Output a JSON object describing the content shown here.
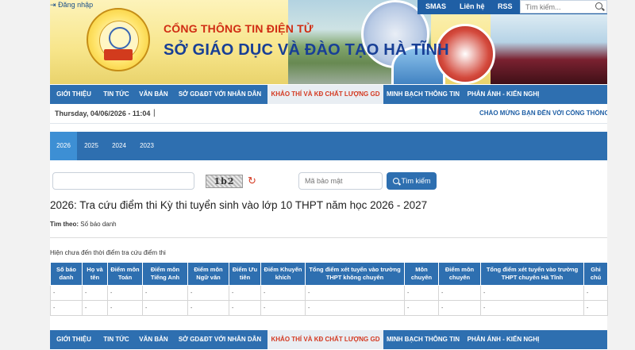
{
  "header": {
    "login_label": "Đăng nhập",
    "portal_label": "CỔNG THÔNG TIN ĐIỆN TỬ",
    "department_name": "SỞ GIÁO DỤC VÀ ĐÀO TẠO HÀ TĨNH",
    "top_links": [
      "SMAS",
      "Liên hệ",
      "RSS"
    ],
    "search_placeholder": "Tìm kiếm..."
  },
  "nav": {
    "items": [
      "GIỚI THIỆU",
      "TIN TỨC",
      "VĂN BẢN",
      "SỞ GD&ĐT VỚI NHÂN DÂN",
      "KHẢO THÍ VÀ KĐ CHẤT LƯỢNG GD",
      "MINH BẠCH THÔNG TIN",
      "PHẢN ÁNH - KIẾN NGHỊ"
    ],
    "active_index": 4
  },
  "dateline": {
    "date": "Thursday, 04/06/2026 - 11:04",
    "separator": "|",
    "marquee": "CHÀO MỪNG BẠN ĐẾN VỚI CỔNG THÔNG TIN"
  },
  "years": {
    "items": [
      "2026",
      "2025",
      "2024",
      "2023"
    ],
    "active_index": 0
  },
  "form": {
    "id_value": "",
    "captcha_text": "1b2",
    "security_placeholder": "Mã bảo mật",
    "search_button": "Tìm kiếm"
  },
  "content": {
    "title": "2026: Tra cứu điểm thi Kỳ thi tuyển sinh vào lớp 10 THPT năm học 2026 - 2027",
    "lookup_label": "Tìm theo:",
    "lookup_value": "Số báo danh",
    "notice": "Hiện chưa đến thời điểm tra cứu điểm thi"
  },
  "table": {
    "headers": [
      "Số báo danh",
      "Họ và tên",
      "Điểm môn Toán",
      "Điểm môn Tiếng Anh",
      "Điểm môn Ngữ văn",
      "Điểm Ưu tiên",
      "Điểm Khuyến khích",
      "Tổng điểm xét tuyển vào trường THPT không chuyên",
      "Môn chuyên",
      "Điểm môn chuyên",
      "Tổng điểm xét tuyển vào trường THPT chuyên Hà Tĩnh",
      "Ghi chú"
    ],
    "rows": [
      [
        "-",
        "-",
        "-",
        "-",
        "-",
        "-",
        "-",
        "-",
        "-",
        "-",
        "-",
        "-"
      ],
      [
        "-",
        "-",
        "-",
        "-",
        "-",
        "-",
        "-",
        "-",
        "-",
        "-",
        "-",
        "-"
      ]
    ]
  },
  "colors": {
    "nav_blue": "#2e6fb0",
    "active_red": "#d43a22",
    "title_blue": "#183f96"
  }
}
